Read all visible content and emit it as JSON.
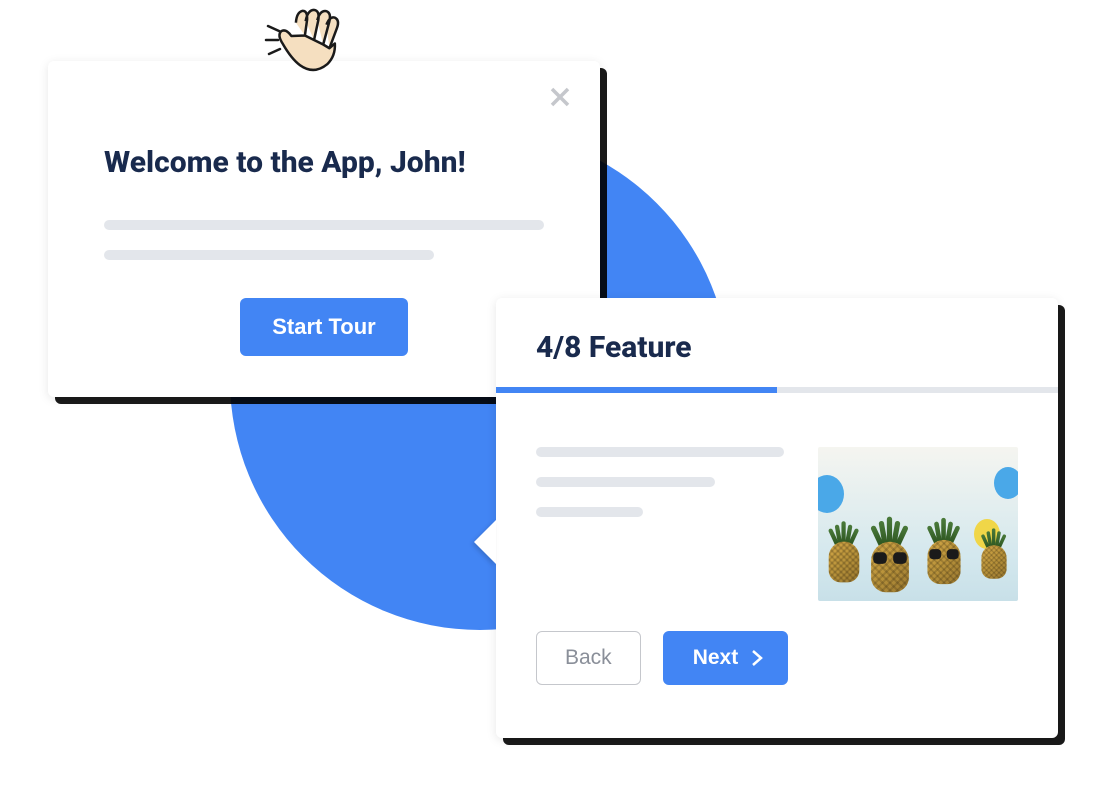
{
  "welcome": {
    "title": "Welcome to the App, John!",
    "cta_label": "Start Tour"
  },
  "feature": {
    "step_current": 4,
    "step_total": 8,
    "title_label": "Feature",
    "title_full": "4/8 Feature",
    "progress_percent": 50,
    "back_label": "Back",
    "next_label": "Next"
  },
  "colors": {
    "primary": "#4285f4",
    "text_dark": "#192a4d",
    "placeholder": "#e3e6eb"
  }
}
